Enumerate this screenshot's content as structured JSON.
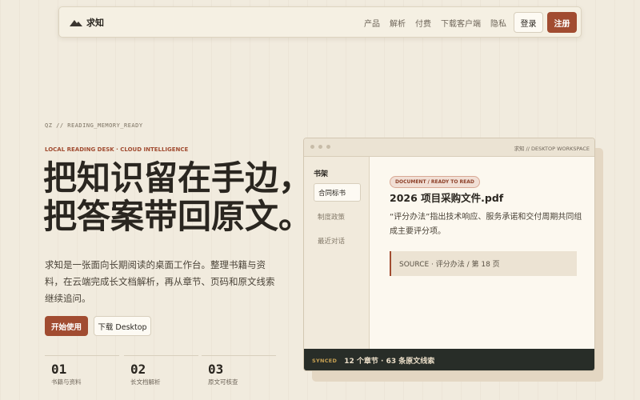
{
  "brand": {
    "name": "求知",
    "icon": "mountain-logo-icon"
  },
  "nav": {
    "links": [
      "产品",
      "解析",
      "付费",
      "下载客户端",
      "隐私"
    ],
    "login": "登录",
    "signup": "注册"
  },
  "hero": {
    "status_line": "QZ // READING_MEMORY_READY",
    "eyebrow": "LOCAL READING DESK · CLOUD INTELLIGENCE",
    "headline_line1": "把知识留在手边，",
    "headline_line2": "把答案带回原文。",
    "description": "求知是一张面向长期阅读的桌面工作台。整理书籍与资料，在云端完成长文档解析，再从章节、页码和原文线索继续追问。",
    "primary_button": "开始使用",
    "secondary_button": "下载 Desktop"
  },
  "stats": [
    {
      "num": "01",
      "label": "书籍与资料"
    },
    {
      "num": "02",
      "label": "长文档解析"
    },
    {
      "num": "03",
      "label": "原文可核查"
    }
  ],
  "window": {
    "title": "求知 // DESKTOP WORKSPACE",
    "sidebar": {
      "heading": "书架",
      "items": [
        "合同标书",
        "制度政策",
        "最近对话"
      ]
    },
    "badge": "DOCUMENT / READY TO READ",
    "doc_title": "2026 项目采购文件.pdf",
    "summary": "“评分办法”指出技术响应、服务承诺和交付周期共同组成主要评分项。",
    "source": "SOURCE · 评分办法 / 第 18 页",
    "footer_status": "SYNCED",
    "footer_text": "12 个章节 · 63 条原文线索"
  },
  "colors": {
    "accent": "#a14c31",
    "background": "#f1ebde",
    "footer_bg": "#282d28",
    "synced": "#c9a253"
  }
}
